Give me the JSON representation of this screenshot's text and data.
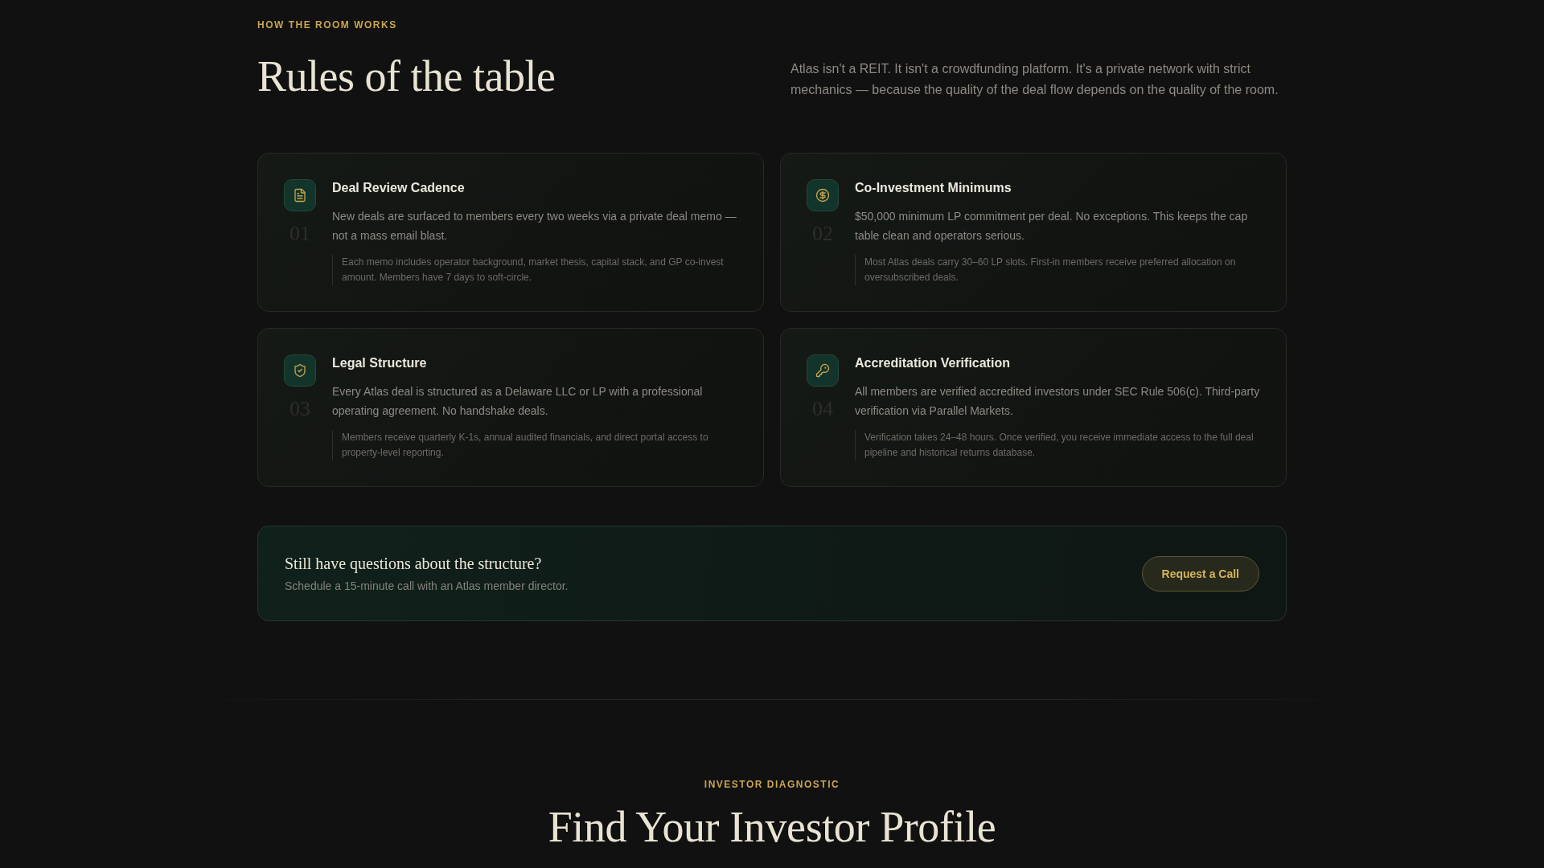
{
  "section_label": "HOW THE ROOM WORKS",
  "title": "Rules of the table",
  "intro": "Atlas isn't a REIT. It isn't a crowdfunding platform. It's a private network with strict mechanics — because the quality of the deal flow depends on the quality of the room.",
  "rules": [
    {
      "number": "01",
      "title": "Deal Review Cadence",
      "body": "New deals are surfaced to members every two weeks via a private deal memo — not a mass email blast.",
      "note": "Each memo includes operator background, market thesis, capital stack, and GP co-invest amount. Members have 7 days to soft-circle."
    },
    {
      "number": "02",
      "title": "Co-Investment Minimums",
      "body": "$50,000 minimum LP commitment per deal. No exceptions. This keeps the cap table clean and operators serious.",
      "note": "Most Atlas deals carry 30–60 LP slots. First-in members receive preferred allocation on oversubscribed deals."
    },
    {
      "number": "03",
      "title": "Legal Structure",
      "body": "Every Atlas deal is structured as a Delaware LLC or LP with a professional operating agreement. No handshake deals.",
      "note": "Members receive quarterly K-1s, annual audited financials, and direct portal access to property-level reporting."
    },
    {
      "number": "04",
      "title": "Accreditation Verification",
      "body": "All members are verified accredited investors under SEC Rule 506(c). Third-party verification via Parallel Markets.",
      "note": "Verification takes 24–48 hours. Once verified, you receive immediate access to the full deal pipeline and historical returns database."
    }
  ],
  "cta": {
    "title": "Still have questions about the structure?",
    "subtitle": "Schedule a 15-minute call with an Atlas member director.",
    "button": "Request a Call"
  },
  "next_section": {
    "section_label": "INVESTOR DIAGNOSTIC",
    "title": "Find Your Investor Profile"
  }
}
